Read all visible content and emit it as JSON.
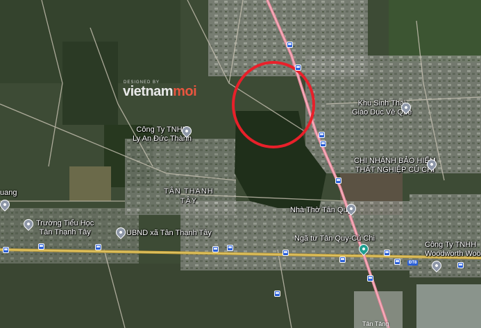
{
  "watermark": {
    "designed_by": "DESIGNED BY",
    "brand_main": "vietnam",
    "brand_accent": "moi"
  },
  "area_label": {
    "line1": "TÂN THẠNH",
    "line2": "TÂY"
  },
  "places": {
    "khu_sinh_thai": {
      "line1": "Khu Sinh Thái",
      "line2": "Giáo Dục Về Quê"
    },
    "cong_ty_ly_an": {
      "line1": "Công Ty TNHH",
      "line2": "Ly An Đức Thành"
    },
    "bao_hiem": {
      "line1": "CHI NHÁNH BẢO HIỂM",
      "line2": "THẤT NGHIỆP CỦ CHI"
    },
    "nha_tho": "Nhà Thờ Tân Quy",
    "truong": {
      "line1": "Trường Tiểu Học",
      "line2": "Tân Thạnh Tây"
    },
    "ubnd": "UBND xã Tân Thạnh Tây",
    "nga_tu": "Ngã tư Tân Quy-Củ Chi",
    "woodworth": {
      "line1": "Công Ty TNHH",
      "line2": "Woodworth Wood"
    },
    "left_cut": "uang",
    "bottom_cut": "Tân Tăng"
  },
  "road_shield": "ĐT8",
  "colors": {
    "highlight_circle": "#e8202a",
    "main_road": "#e8879a",
    "bus_stop": "#2a5fd6",
    "pin": "#8e97a8"
  }
}
